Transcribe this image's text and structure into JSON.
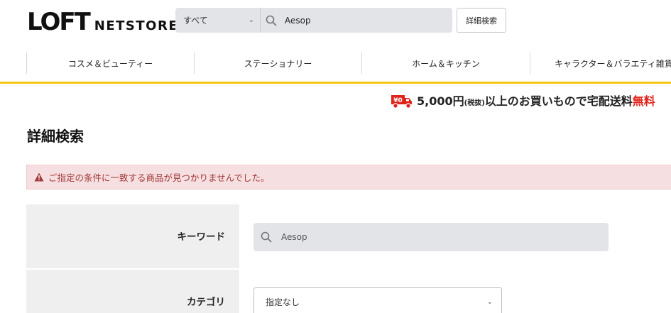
{
  "header": {
    "logo_main": "LOFT",
    "logo_sub": "NETSTORE",
    "search_category": "すべて",
    "search_value": "Aesop",
    "advanced_search_label": "詳細検索"
  },
  "nav": {
    "items": [
      {
        "label": "コスメ＆ビューティー"
      },
      {
        "label": "ステーショナリー"
      },
      {
        "label": "ホーム＆キッチン"
      },
      {
        "label": "キャラクター＆バラエティ雑貨"
      }
    ]
  },
  "shipping": {
    "badge": "¥0",
    "amount": "5,000円",
    "tax_note": "(税抜)",
    "text": "以上のお買いもので宅配送料",
    "free": "無料"
  },
  "page": {
    "title": "詳細検索",
    "alert": "ご指定の条件に一致する商品が見つかりませんでした。"
  },
  "form": {
    "keyword_label": "キーワード",
    "keyword_value": "Aesop",
    "category_label": "カテゴリ",
    "category_value": "指定なし"
  },
  "colors": {
    "accent_yellow": "#f7c614",
    "alert_bg": "#f6dfe0",
    "alert_text": "#a23a3c",
    "free_red": "#e0241b"
  }
}
